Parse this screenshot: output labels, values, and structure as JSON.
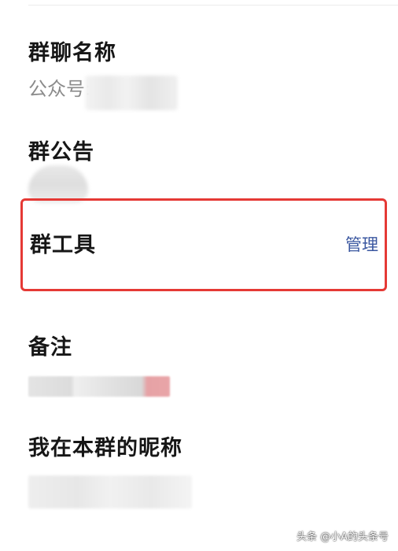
{
  "group_name": {
    "title": "群聊名称",
    "account_label": "公众号:"
  },
  "announcement": {
    "title": "群公告"
  },
  "group_tools": {
    "title": "群工具",
    "manage_label": "管理"
  },
  "remark": {
    "title": "备注"
  },
  "nickname": {
    "title": "我在本群的昵称"
  },
  "watermark": {
    "text": "头条 @小A的头条号"
  },
  "colors": {
    "highlight_border": "#e53935",
    "link": "#3a57a0",
    "secondary_text": "#8b8b8b"
  }
}
